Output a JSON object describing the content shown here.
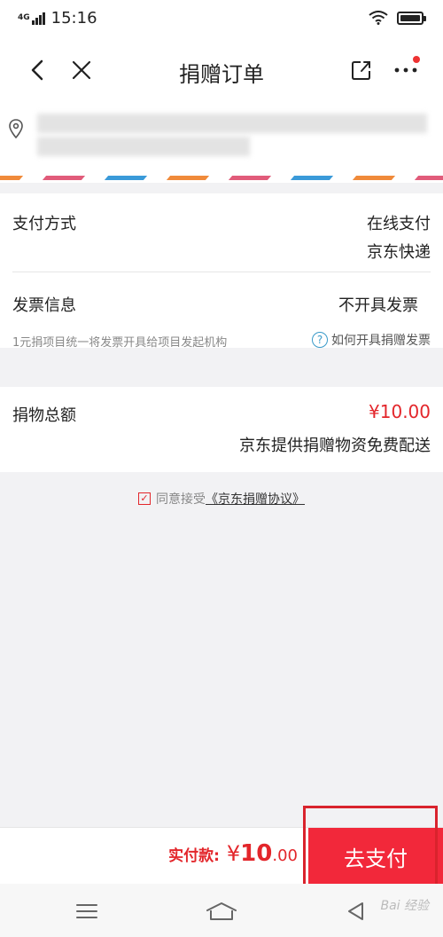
{
  "status_bar": {
    "network": "4G",
    "time": "15:16"
  },
  "nav": {
    "title": "捐赠订单"
  },
  "payment": {
    "label": "支付方式",
    "value": "在线支付",
    "delivery": "京东快递"
  },
  "invoice": {
    "label": "发票信息",
    "value": "不开具发票",
    "note": "1元捐项目统一将发票开具给项目发起机构",
    "help": "如何开具捐赠发票"
  },
  "donation": {
    "label": "捐物总额",
    "amount": "¥10.00",
    "note": "京东提供捐赠物资免费配送"
  },
  "agreement": {
    "check_mark": "✓",
    "text": "同意接受",
    "link": "《京东捐赠协议》"
  },
  "bottom": {
    "total_label": "实付款:",
    "yen": "¥",
    "amount_int": "10",
    "amount_dec": ".00",
    "pay_button": "去支付"
  },
  "watermark": "Bai 经验",
  "colors": {
    "accent": "#e3262b",
    "pay_button": "#f2283a",
    "stripe": [
      "#f08a3a",
      "#e15b7a",
      "#3a9ad9"
    ]
  }
}
